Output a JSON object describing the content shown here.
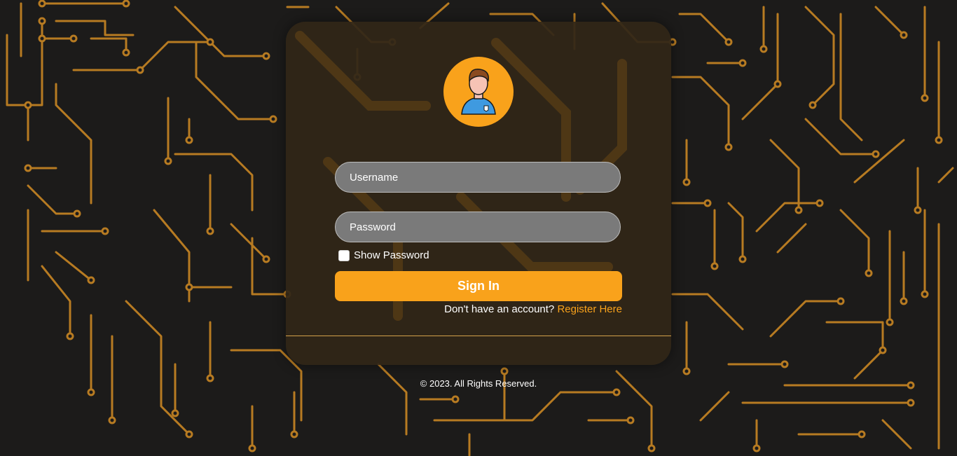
{
  "login": {
    "username_placeholder": "Username",
    "password_placeholder": "Password",
    "show_password_label": "Show Password",
    "sign_in_label": "Sign In",
    "register_prompt": "Don't have an account?",
    "register_link": "Register Here"
  },
  "footer": {
    "copyright": "© 2023. All Rights Reserved."
  },
  "colors": {
    "accent": "#f9a21b",
    "background": "#1c1b1a",
    "circuit": "#b77b22"
  },
  "icons": {
    "avatar": "user-avatar-icon"
  }
}
